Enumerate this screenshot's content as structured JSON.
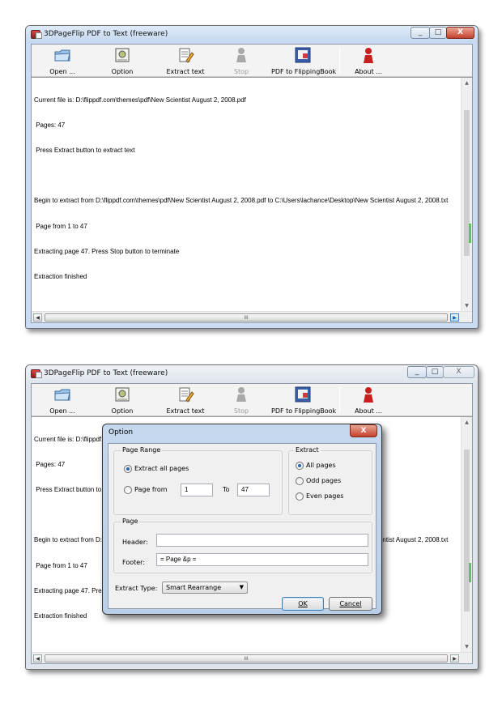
{
  "window": {
    "title": "3DPageFlip PDF to Text (freeware)",
    "controls": [
      "_",
      "□",
      "X"
    ]
  },
  "toolbar": {
    "buttons": [
      {
        "label": "Open ...",
        "icon": "folder-icon",
        "enabled": true
      },
      {
        "label": "Option",
        "icon": "option-icon",
        "enabled": true
      },
      {
        "label": "Extract text",
        "icon": "extract-text-icon",
        "enabled": true
      },
      {
        "label": "Stop",
        "icon": "stop-icon",
        "enabled": false
      },
      {
        "label": "PDF to FlippingBook",
        "icon": "flippingbook-icon",
        "enabled": true
      },
      {
        "label": "About ...",
        "icon": "about-person-icon",
        "enabled": true
      }
    ]
  },
  "output_lines": [
    "Current file is: D:\\flippdf.com\\themes\\pdf\\New Scientist August 2, 2008.pdf",
    " Pages: 47",
    " Press Extract button to extract text",
    "",
    "Begin to extract from D:\\flippdf.com\\themes\\pdf\\New Scientist August 2, 2008.pdf to C:\\Users\\lachance\\Desktop\\New Scientist August 2, 2008.txt",
    " Page from 1 to 47",
    "Extracting page 47. Press Stop button to terminate",
    "Extraction finished"
  ],
  "scrollbar": {
    "thumb_grip": "III"
  },
  "dialog": {
    "title": "Option",
    "close_label": "X",
    "page_range": {
      "title": "Page Range",
      "extract_all_label": "Extract all pages",
      "page_from_label": "Page from",
      "selected": "all",
      "from_value": "1",
      "to_label": "To",
      "to_value": "47"
    },
    "extract": {
      "title": "Extract",
      "options": [
        "All pages",
        "Odd pages",
        "Even pages"
      ],
      "selected": "All pages"
    },
    "page": {
      "title": "Page",
      "header_label": "Header:",
      "header_value": "",
      "footer_label": "Footer:",
      "footer_value": "= Page &p ="
    },
    "extract_type": {
      "label": "Extract Type:",
      "value": "Smart Rearrange"
    },
    "ok_label": "OK",
    "cancel_label": "Cancel"
  }
}
